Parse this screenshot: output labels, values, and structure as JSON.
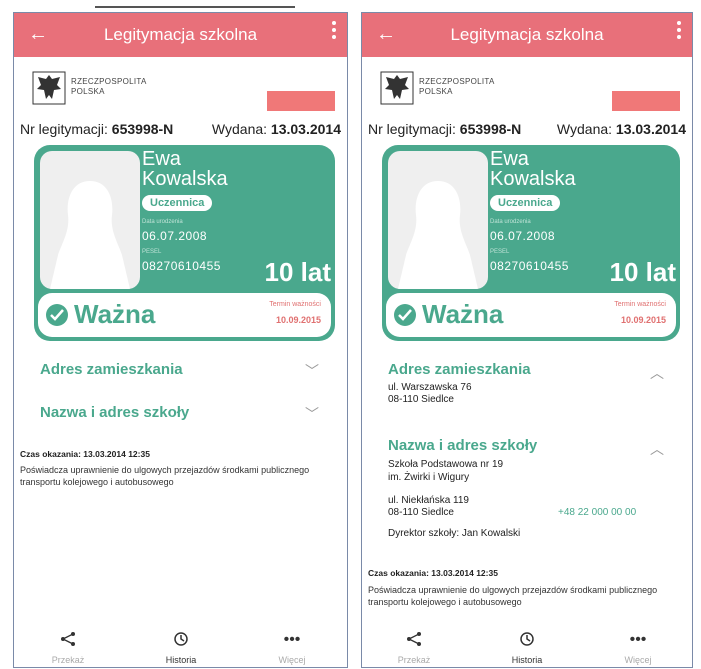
{
  "screens": [
    {
      "app_title": "Legitymacja szkolna",
      "header": {
        "republic_line1": "RZECZPOSPOLITA",
        "republic_line2": "POLSKA"
      },
      "id_row": {
        "nr_label": "Nr legitymacji:",
        "nr_value": "653998-N",
        "issued_label": "Wydana:",
        "issued_value": "13.03.2014"
      },
      "card": {
        "first_name": "Ewa",
        "last_name": "Kowalska",
        "badge": "Uczennica",
        "birth_label": "Data urodzenia",
        "birth_value": "06.07.2008",
        "pesel_label": "PESEL",
        "pesel_value": "08270610455",
        "age": "10 lat",
        "status": "Ważna",
        "term_label": "Termin ważności",
        "term_value": "10.09.2015"
      },
      "sections": {
        "address_title": "Adres zamieszkania",
        "school_title": "Nazwa i adres szkoły"
      },
      "footer": {
        "shown_time": "Czas okazania: 13.03.2014 12:35",
        "text": "Poświadcza uprawnienie do ulgowych przejazdów środkami publicznego transportu kolejowego i autobusowego"
      },
      "nav": {
        "share": "Przekaż",
        "history": "Historia",
        "more": "Więcej"
      }
    },
    {
      "app_title": "Legitymacja szkolna",
      "header": {
        "republic_line1": "RZECZPOSPOLITA",
        "republic_line2": "POLSKA"
      },
      "id_row": {
        "nr_label": "Nr legitymacji:",
        "nr_value": "653998-N",
        "issued_label": "Wydana:",
        "issued_value": "13.03.2014"
      },
      "card": {
        "first_name": "Ewa",
        "last_name": "Kowalska",
        "badge": "Uczennica",
        "birth_label": "Data urodzenia",
        "birth_value": "06.07.2008",
        "pesel_label": "PESEL",
        "pesel_value": "08270610455",
        "age": "10 lat",
        "status": "Ważna",
        "term_label": "Termin ważności",
        "term_value": "10.09.2015"
      },
      "sections": {
        "address_title": "Adres zamieszkania",
        "address_line1": "ul. Warszawska 76",
        "address_line2": "08-110 Siedlce",
        "school_title": "Nazwa i adres szkoły",
        "school_name1": "Szkoła Podstawowa nr 19",
        "school_name2": "im. Żwirki i Wigury",
        "school_street": "ul. Niekłańska 119",
        "school_city": "08-110 Siedlce",
        "school_phone": "+48 22 000 00 00",
        "director": "Dyrektor szkoły: Jan Kowalski"
      },
      "footer": {
        "shown_time": "Czas okazania: 13.03.2014 12:35",
        "text": "Poświadcza uprawnienie do ulgowych przejazdów środkami publicznego transportu kolejowego i autobusowego"
      },
      "nav": {
        "share": "Przekaż",
        "history": "Historia",
        "more": "Więcej"
      }
    }
  ],
  "colors": {
    "accent": "#e8707a",
    "green": "#4aa88d",
    "redbar": "#f07878"
  },
  "icons": {
    "back": "arrow-left-icon",
    "menu": "kebab-menu-icon",
    "emblem": "polish-eagle-icon",
    "share": "share-icon",
    "history": "history-icon",
    "more": "more-dots-icon",
    "status": "check-circle-icon",
    "expand": "chevron-down-icon",
    "collapse": "chevron-up-icon"
  }
}
